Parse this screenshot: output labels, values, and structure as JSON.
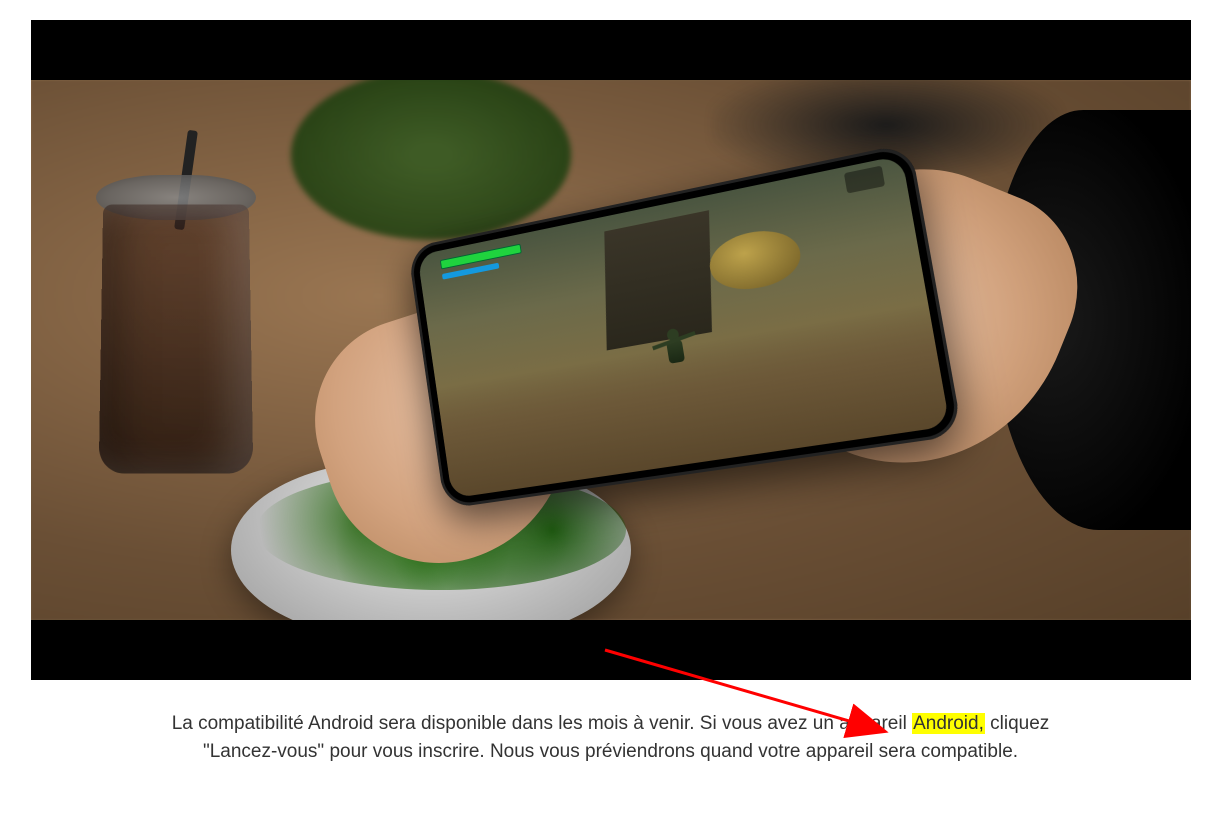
{
  "caption": {
    "before": "La compatibilité Android sera disponible dans les mois à venir. Si vous avez un appareil ",
    "highlighted": "Android,",
    "after": " cliquez \"Lancez-vous\" pour vous inscrire. Nous vous préviendrons quand votre appareil sera compatible."
  },
  "annotation": {
    "arrow_color": "#ff0000"
  }
}
